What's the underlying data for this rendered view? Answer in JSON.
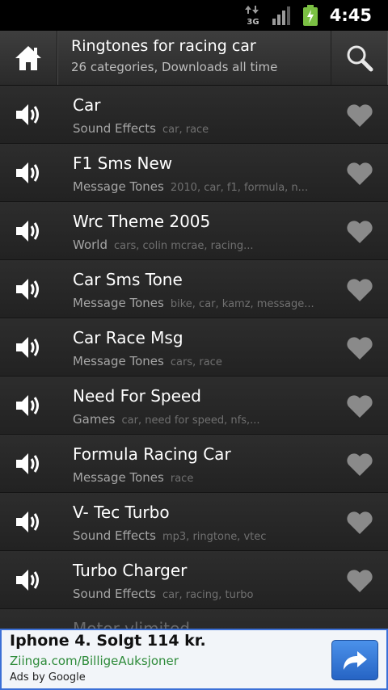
{
  "status_bar": {
    "network": "3G",
    "time": "4:45"
  },
  "header": {
    "title": "Ringtones for racing car",
    "subtitle": "26 categories, Downloads all time"
  },
  "items": [
    {
      "title": "Car",
      "category": "Sound Effects",
      "tags": "car, race"
    },
    {
      "title": "F1 Sms New",
      "category": "Message Tones",
      "tags": "2010, car, f1, formula, n..."
    },
    {
      "title": "Wrc Theme 2005",
      "category": "World",
      "tags": "cars, colin mcrae, racing..."
    },
    {
      "title": "Car Sms Tone",
      "category": "Message Tones",
      "tags": "bike, car, kamz, message..."
    },
    {
      "title": "Car Race Msg",
      "category": "Message Tones",
      "tags": "cars, race"
    },
    {
      "title": "Need For Speed",
      "category": "Games",
      "tags": "car, need for speed, nfs,..."
    },
    {
      "title": "Formula Racing Car",
      "category": "Message Tones",
      "tags": "race"
    },
    {
      "title": "V- Tec Turbo",
      "category": "Sound Effects",
      "tags": "mp3, ringtone, vtec"
    },
    {
      "title": "Turbo Charger",
      "category": "Sound Effects",
      "tags": "car, racing, turbo"
    },
    {
      "title": "Motor vlimited",
      "category": "",
      "tags": ""
    }
  ],
  "ad": {
    "title": "Iphone 4. Solgt 114 kr.",
    "url": "Ziinga.com/BilligeAuksjoner",
    "byline": "Ads by Google"
  },
  "colors": {
    "background": "#1b1b1b",
    "ad_url": "#2e8b3a",
    "ad_border": "#3b6fd6",
    "battery": "#7bc043"
  }
}
